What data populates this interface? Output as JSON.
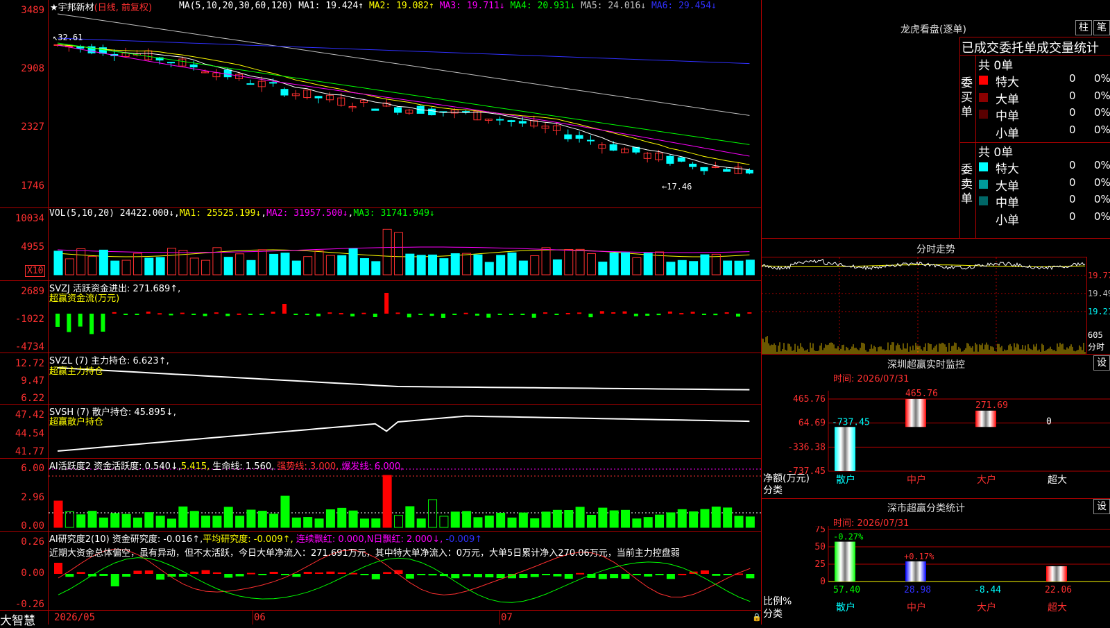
{
  "stock": {
    "title": "★宇邦新材",
    "mode": "(日线, 前复权)",
    "ma_header": "MA(5,10,20,30,60,120)",
    "ma": [
      {
        "label": "MA1: 19.424↑",
        "color": "#ffffff"
      },
      {
        "label": "MA2: 19.082↑",
        "color": "#ffff00"
      },
      {
        "label": "MA3: 19.711↓",
        "color": "#ff00ff"
      },
      {
        "label": "MA4: 20.931↓",
        "color": "#00ff00"
      },
      {
        "label": "MA5: 24.016↓",
        "color": "#c0c0c0"
      },
      {
        "label": "MA6: 29.454↓",
        "color": "#0000ff"
      }
    ],
    "axis": [
      "3489",
      "2908",
      "2327",
      "1746"
    ],
    "high_marker": "32.61",
    "low_marker": "←17.46"
  },
  "vol": {
    "header": "VOL(5,10,20)",
    "value": "24422.000↓",
    "ma1": "MA1: 25525.199↓",
    "ma2": "MA2: 31957.500↓",
    "ma3": "MA3: 31741.949↓",
    "axis": [
      "10034",
      "4955"
    ],
    "unit": "X10"
  },
  "svzj": {
    "header": "SVZJ  活跃资金进出: 271.689↑,",
    "sub": "超赢资金流(万元)",
    "axis": [
      "2689",
      "-1022",
      "-4734"
    ]
  },
  "svzl": {
    "header": "SVZL (7) 主力持仓: 6.623↑,",
    "sub": "超赢主力持仓",
    "axis": [
      "12.72",
      "9.47",
      "6.22"
    ]
  },
  "svsh": {
    "header": "SVSH (7) 散户持仓: 45.895↓,",
    "sub": "超赢散户持仓",
    "axis": [
      "47.42",
      "44.54",
      "41.77"
    ]
  },
  "ai_act": {
    "header": "AI活跃度2 资金活跃度: 0.540↓,",
    "v2": "5.415,",
    "life": "生命线: 1.560,",
    "strong": "强势线: 3.000,",
    "burst": "爆发线: 6.000,",
    "axis": [
      "6.00",
      "2.96",
      "0.00"
    ]
  },
  "ai_res": {
    "header": "AI研究度2(10) 资金研究度: -0.016↑,",
    "avg": "平均研究度: -0.009↑,",
    "red": "连续飘红: 0.000,",
    "nred": "N日飘红: 2.000↓,",
    "last": "-0.009↑",
    "comment": "近期大资金总体偏空，虽有异动，但不太活跃，今日大单净流入：271.691万元，其中特大单净流入：0万元，大单5日累计净入270.06万元，当前主力控盘弱",
    "axis": [
      "0.26",
      "0.00",
      "-0.26"
    ]
  },
  "dates": [
    "2026/05",
    "06",
    "07"
  ],
  "brand": "大智慧",
  "dragon": {
    "title": "龙虎看盘(逐单)",
    "btn1": "柱",
    "btn2": "笔",
    "tabs": "已成交委托单成交量统计",
    "buy_label": "委买单",
    "sell_label": "委卖单",
    "buy_total": "共 0单",
    "sell_total": "共 0单",
    "buy_rows": [
      {
        "name": "特大",
        "count": "0",
        "pct": "0%",
        "color": "#ff0000"
      },
      {
        "name": "大单",
        "count": "0",
        "pct": "0%",
        "color": "#8b0000"
      },
      {
        "name": "中单",
        "count": "0",
        "pct": "0%",
        "color": "#5a0000"
      },
      {
        "name": "小单",
        "count": "0",
        "pct": "0%",
        "color": ""
      }
    ],
    "sell_rows": [
      {
        "name": "特大",
        "count": "0",
        "pct": "0%",
        "color": "#00ffff"
      },
      {
        "name": "大单",
        "count": "0",
        "pct": "0%",
        "color": "#009999"
      },
      {
        "name": "中单",
        "count": "0",
        "pct": "0%",
        "color": "#006666"
      },
      {
        "name": "小单",
        "count": "0",
        "pct": "0%",
        "color": ""
      }
    ]
  },
  "intraday": {
    "title": "分时走势",
    "axis": [
      "19.77",
      "19.49",
      "19.21"
    ],
    "vol_label": "605",
    "vol_unit": "分时"
  },
  "monitor": {
    "title": "深圳超赢实时监控",
    "btn": "设",
    "time": "时间: 2026/07/31",
    "axis": [
      "465.76",
      "64.69",
      "-336.38",
      "-737.45"
    ],
    "ylabel": "净额(万元)",
    "xlabel": "分类",
    "categories": [
      "散户",
      "中户",
      "大户",
      "超大"
    ],
    "values": [
      -737.45,
      465.76,
      271.69,
      0
    ],
    "labels": [
      "-737.45",
      "465.76",
      "271.69",
      "0"
    ]
  },
  "classify": {
    "title": "深市超赢分类统计",
    "btn": "设",
    "time": "时间: 2026/07/31",
    "axis": [
      "75",
      "50",
      "25",
      "0"
    ],
    "ylabel": "比例%",
    "xlabel": "分类",
    "categories": [
      "散户",
      "中户",
      "大户",
      "超大"
    ],
    "values": [
      57.4,
      28.98,
      -8.44,
      22.06
    ],
    "top_labels": [
      "-0.27%",
      "+0.17%",
      "",
      ""
    ],
    "bottom_labels": [
      "57.40",
      "28.98",
      "-8.44",
      "22.06"
    ]
  }
}
